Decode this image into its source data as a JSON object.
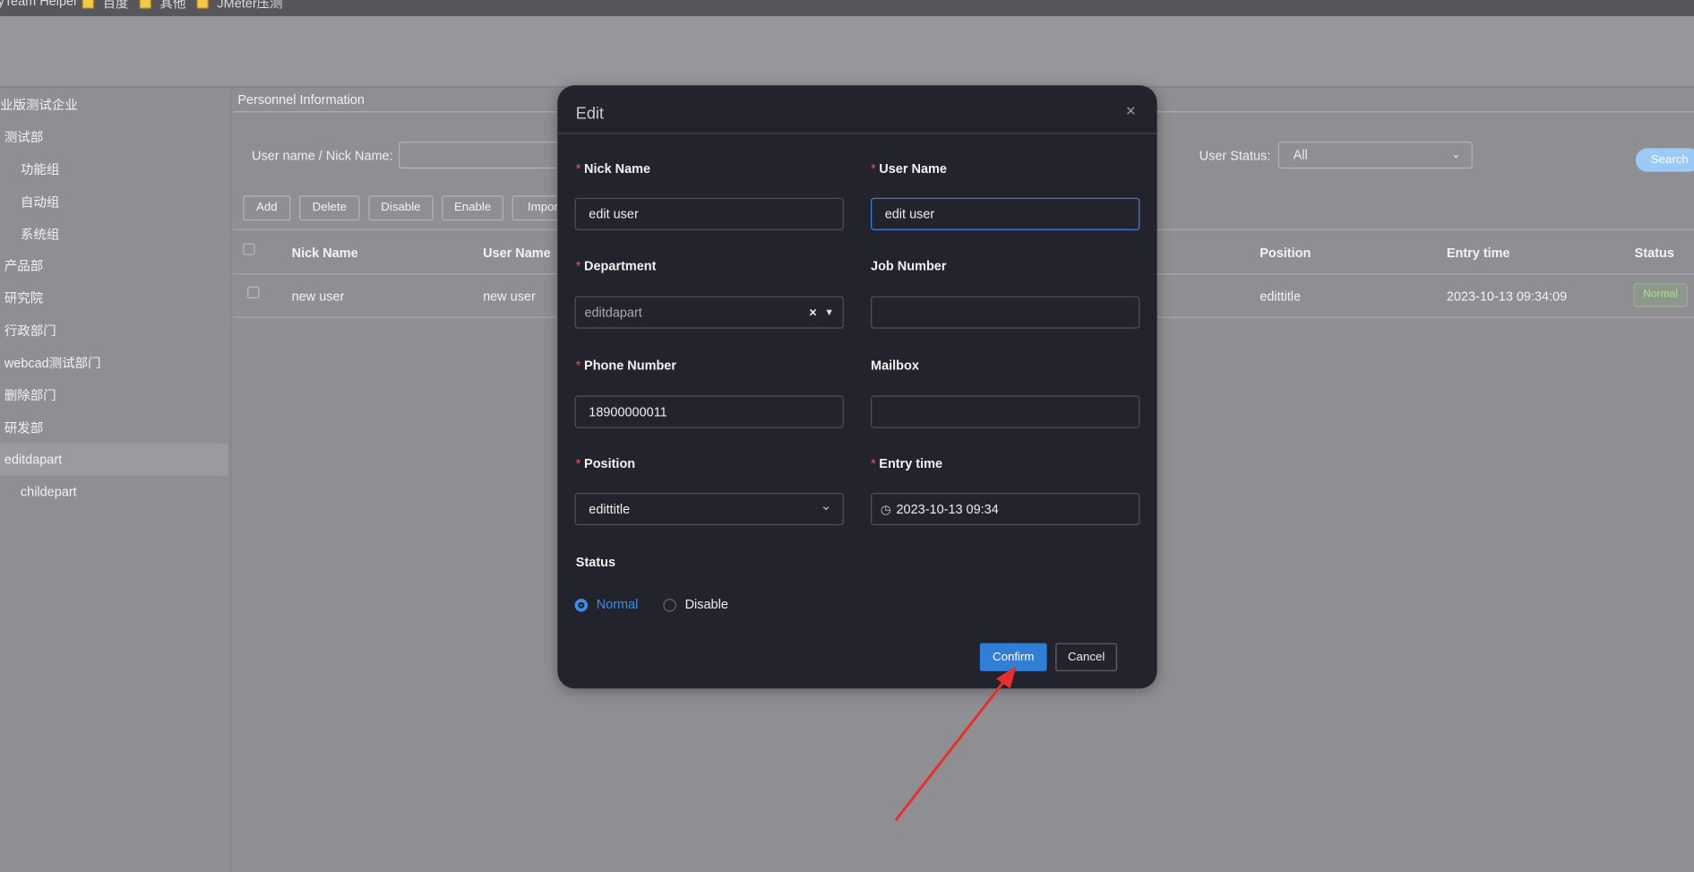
{
  "bookmarks": [
    "yTeam Helper",
    "百度",
    "其他",
    "JMeter压测"
  ],
  "breadcrumb": "Personnel Information",
  "sidebar": {
    "items": [
      {
        "label": "业版测试企业"
      },
      {
        "label": "测试部"
      },
      {
        "label": "功能组"
      },
      {
        "label": "自动组"
      },
      {
        "label": "系统组"
      },
      {
        "label": "产品部"
      },
      {
        "label": "研究院"
      },
      {
        "label": "行政部门"
      },
      {
        "label": "webcad测试部门"
      },
      {
        "label": "删除部门"
      },
      {
        "label": "研发部"
      },
      {
        "label": "editdapart"
      },
      {
        "label": "childepart"
      }
    ],
    "selected": "editdapart"
  },
  "filters": {
    "name_label": "User name / Nick Name:",
    "name_value": "",
    "status_label": "User Status:",
    "status_value": "All",
    "search": "Search"
  },
  "toolbar": {
    "add": "Add",
    "delete": "Delete",
    "disable": "Disable",
    "enable": "Enable",
    "import": "Import"
  },
  "table": {
    "headers": {
      "nick": "Nick Name",
      "user": "User Name",
      "position": "Position",
      "entry": "Entry time",
      "status": "Status"
    },
    "rows": [
      {
        "nick": "new user",
        "user": "new user",
        "position": "edittitle",
        "entry": "2023-10-13 09:34:09",
        "status": "Normal"
      }
    ]
  },
  "modal": {
    "title": "Edit",
    "close": "×",
    "fields": {
      "nick": {
        "label": "Nick Name",
        "value": "edit user",
        "required": true
      },
      "user": {
        "label": "User Name",
        "value": "edit user",
        "required": true
      },
      "department": {
        "label": "Department",
        "value": "editdapart",
        "required": true
      },
      "job": {
        "label": "Job Number",
        "value": ""
      },
      "phone": {
        "label": "Phone Number",
        "value": "18900000011",
        "required": true
      },
      "mail": {
        "label": "Mailbox",
        "value": ""
      },
      "position": {
        "label": "Position",
        "value": "edittitle",
        "required": true
      },
      "entry": {
        "label": "Entry time",
        "value": "2023-10-13 09:34",
        "required": true
      }
    },
    "status": {
      "label": "Status",
      "options": [
        "Normal",
        "Disable"
      ],
      "selected": "Normal"
    },
    "confirm": "Confirm",
    "cancel": "Cancel"
  },
  "colors": {
    "accent": "#2f7ed8",
    "modal_bg": "#23232d",
    "annotation_arrow": "#e8302a",
    "status_normal": "#a8e08a"
  }
}
